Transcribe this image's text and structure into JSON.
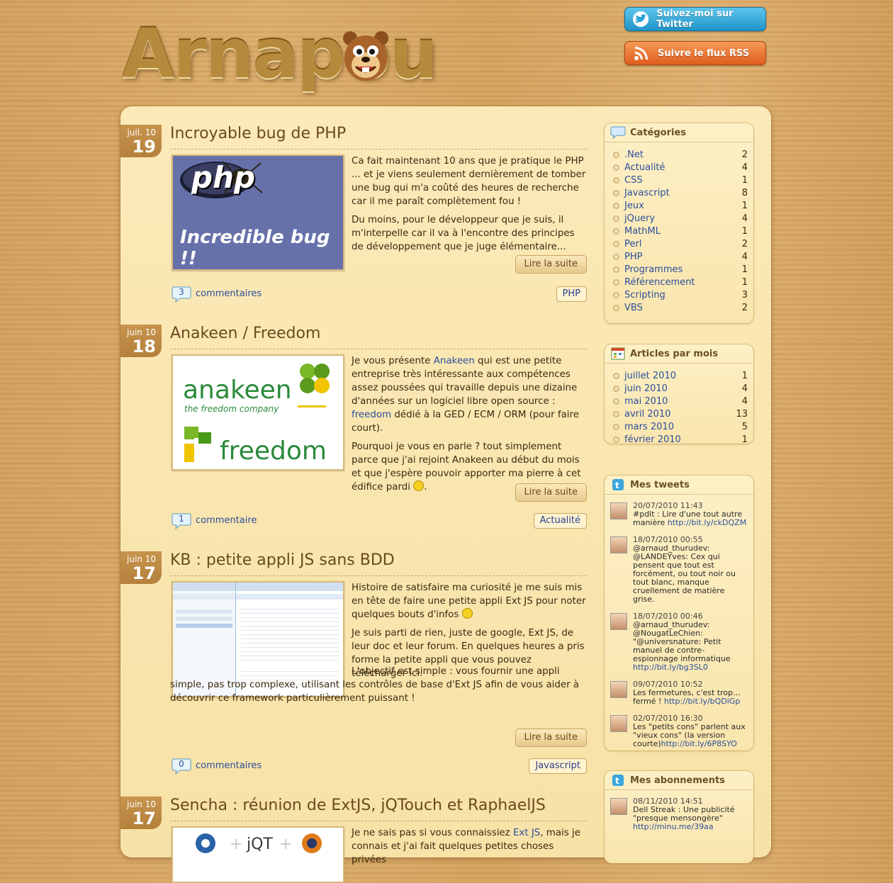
{
  "header": {
    "logo_text": "Arnapou",
    "twitter_button": "Suivez-moi sur Twitter",
    "rss_button": "Suivre le flux RSS"
  },
  "posts": [
    {
      "month": "juil. 10",
      "day": "19",
      "title": "Incroyable bug de PHP",
      "thumb_caption": "Incredible bug !!",
      "thumb_logo": "php",
      "paragraphs": [
        "Ca fait maintenant 10 ans que je pratique le PHP ... et je viens seulement dernièrement de tomber une bug qui m'a coûté des heures de recherche car il me paraît complètement fou !",
        "Du moins, pour le développeur que je suis, il m'interpelle car il va à l'encontre des principes de développement que je juge élémentaire..."
      ],
      "read_more": "Lire la suite",
      "comment_count": "3",
      "comment_label": "commentaires",
      "tag": "PHP"
    },
    {
      "month": "juin 10",
      "day": "18",
      "title": "Anakeen / Freedom",
      "thumb_top": "anakeen",
      "thumb_tagline": "the freedom company",
      "thumb_bottom": "freedom",
      "p1_a": "Je vous présente ",
      "p1_link": "Anakeen",
      "p1_b": " qui est une petite entreprise très intéressante aux compétences assez poussées qui travaille depuis une dizaine d'années sur un logiciel libre open source : ",
      "p1_link2": "freedom",
      "p1_c": " dédié à la GED / ECM / ORM (pour faire court).",
      "p2": "Pourquoi je vous en parle ? tout simplement parce que j'ai rejoint Anakeen au début du mois et que j'espère pouvoir apporter ma pierre à cet édifice pardi",
      "read_more": "Lire la suite",
      "comment_count": "1",
      "comment_label": "commentaire",
      "tag": "Actualité"
    },
    {
      "month": "juin 10",
      "day": "17",
      "title": "KB : petite appli JS sans BDD",
      "paragraphs": [
        "Histoire de satisfaire ma curiosité je me suis mis en tête de faire une petite appli Ext JS pour noter quelques bouts d'infos",
        "Je suis parti de rien, juste de google, Ext JS, de leur doc et leur forum. En quelques heures a pris forme la petite appli que vous pouvez télécharger ici.",
        "L'objectif est simple : vous fournir une appli simple, pas trop complexe, utilisant les contrôles de base d'Ext JS afin de vous aider à découvrir ce framework particulièrement puissant !"
      ],
      "read_more": "Lire la suite",
      "comment_count": "0",
      "comment_label": "commentaires",
      "tag": "Javascript"
    },
    {
      "month": "juin 10",
      "day": "17",
      "title": "Sencha : réunion de ExtJS, jQTouch et RaphaelJS",
      "p1_a": "Je ne sais pas si vous connaissiez ",
      "p1_link": "Ext JS",
      "p1_b": ", mais je connais et j'ai fait quelques petites choses privées"
    }
  ],
  "sidebar": {
    "categories_title": "Catégories",
    "categories": [
      {
        "name": ".Net",
        "count": "2"
      },
      {
        "name": "Actualité",
        "count": "4"
      },
      {
        "name": "CSS",
        "count": "1"
      },
      {
        "name": "Javascript",
        "count": "8"
      },
      {
        "name": "Jeux",
        "count": "1"
      },
      {
        "name": "jQuery",
        "count": "4"
      },
      {
        "name": "MathML",
        "count": "1"
      },
      {
        "name": "Perl",
        "count": "2"
      },
      {
        "name": "PHP",
        "count": "4"
      },
      {
        "name": "Programmes",
        "count": "1"
      },
      {
        "name": "Référencement",
        "count": "1"
      },
      {
        "name": "Scripting",
        "count": "3"
      },
      {
        "name": "VBS",
        "count": "2"
      }
    ],
    "archives_title": "Articles par mois",
    "archives": [
      {
        "name": "juillet 2010",
        "count": "1"
      },
      {
        "name": "juin 2010",
        "count": "4"
      },
      {
        "name": "mai 2010",
        "count": "4"
      },
      {
        "name": "avril 2010",
        "count": "13"
      },
      {
        "name": "mars 2010",
        "count": "5"
      },
      {
        "name": "février 2010",
        "count": "1"
      }
    ],
    "tweets_title": "Mes tweets",
    "tweets": [
      {
        "time": "20/07/2010  11:43",
        "text": "#pdlt : Lire d'une tout autre manière ",
        "link": "http://bit.ly/ckDQZM"
      },
      {
        "time": "18/07/2010  00:55",
        "text": "@arnaud_thurudev: @LANDEYves: Cex qui pensent que tout est forcément, ou tout noir ou tout blanc, manque cruellement de matière grise.",
        "link": ""
      },
      {
        "time": "18/07/2010  00:46",
        "text": "@arnaud_thurudev: @NougatLeChien: \"@universnature: Petit manuel de contre-espionnage informatique ",
        "link": "http://bit.ly/bg3SL0"
      },
      {
        "time": "09/07/2010  10:52",
        "text": "Les fermetures, c'est trop... fermé ! ",
        "link": "http://bit.ly/bQDiGp"
      },
      {
        "time": "02/07/2010  16:30",
        "text": " Les \"petits cons\" parlent aux \"vieux cons\" (la version courte)",
        "link": "http://bit.ly/6P8SYO"
      }
    ],
    "subs_title": "Mes abonnements",
    "subs": [
      {
        "time": "08/11/2010  14:51",
        "text": "Dell Streak : Une publicité \"presque mensongère\" ",
        "link": "http://minu.me/39aa"
      }
    ]
  }
}
